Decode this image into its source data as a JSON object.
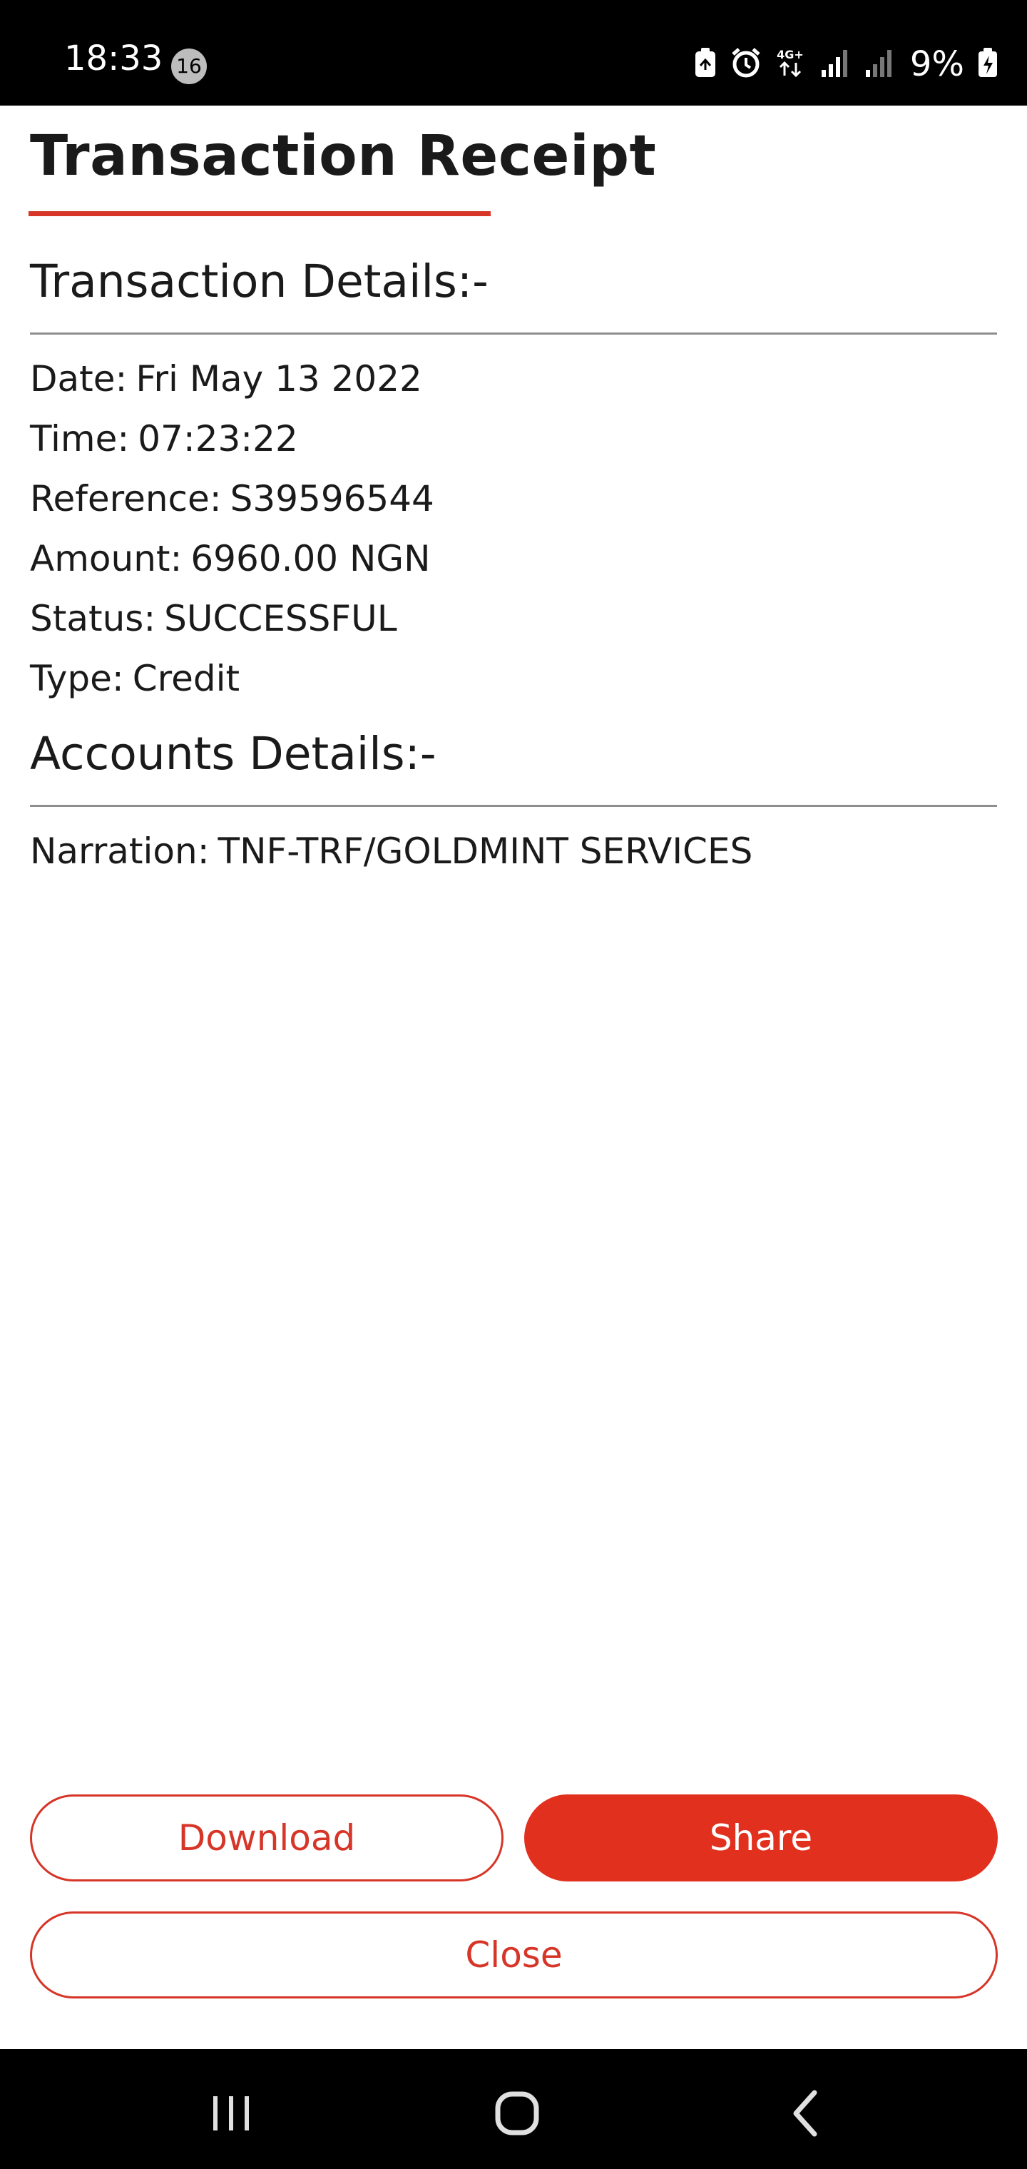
{
  "status_bar": {
    "time": "18:33",
    "notification_count": "16",
    "network": "4G+",
    "battery_percent": "9%"
  },
  "receipt": {
    "title": "Transaction Receipt",
    "accent_color": "#d63527",
    "transaction_section": {
      "heading": "Transaction Details:-",
      "rows": [
        {
          "label": "Date:",
          "value": "Fri May 13 2022"
        },
        {
          "label": "Time:",
          "value": "07:23:22"
        },
        {
          "label": "Reference:",
          "value": "S39596544"
        },
        {
          "label": "Amount:",
          "value": "6960.00 NGN"
        },
        {
          "label": "Status:",
          "value": "SUCCESSFUL"
        },
        {
          "label": "Type:",
          "value": "Credit"
        }
      ]
    },
    "accounts_section": {
      "heading": "Accounts Details:-",
      "rows": [
        {
          "label": "Narration:",
          "value": "TNF-TRF/GOLDMINT SERVICES"
        }
      ]
    }
  },
  "actions": {
    "download_label": "Download",
    "share_label": "Share",
    "close_label": "Close"
  },
  "nav_bar": {
    "recents_icon": "recents-icon",
    "home_icon": "home-icon",
    "back_icon": "back-icon"
  }
}
